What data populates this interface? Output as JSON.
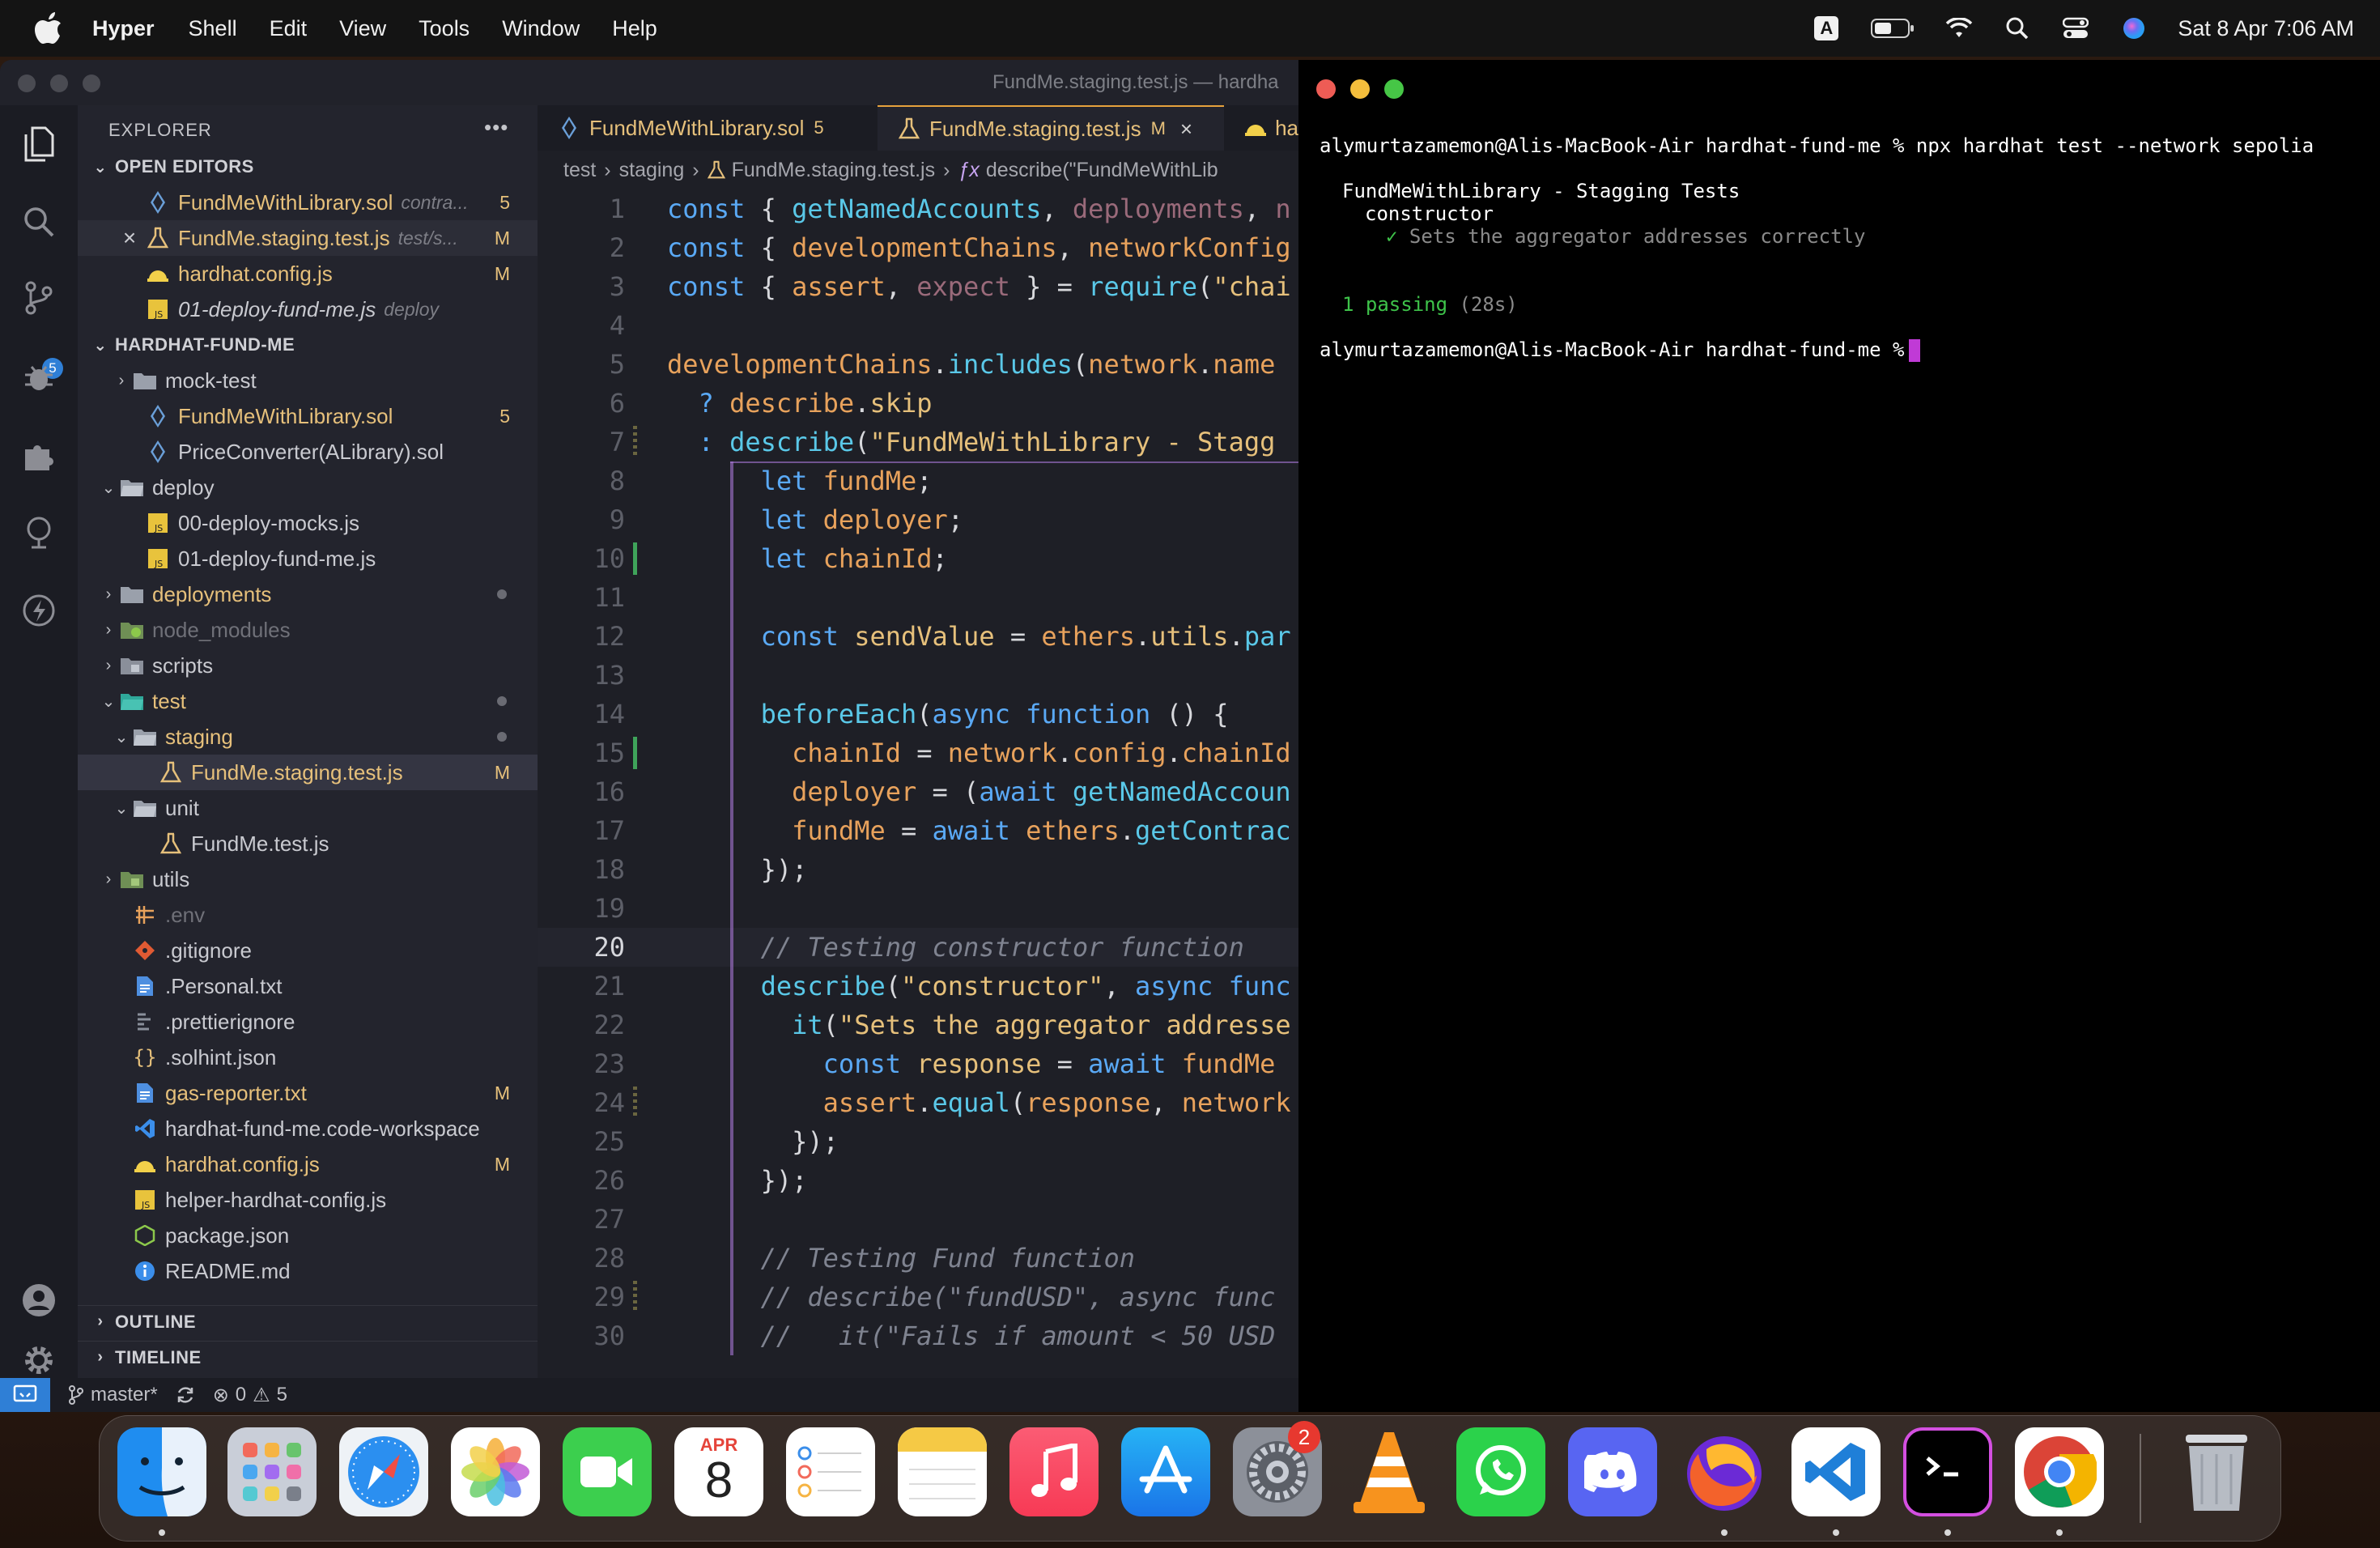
{
  "menubar": {
    "app_name": "Hyper",
    "items": [
      "Shell",
      "Edit",
      "View",
      "Tools",
      "Window",
      "Help"
    ],
    "input_source": "A",
    "clock": "Sat 8 Apr  7:06 AM"
  },
  "vscode": {
    "window_title": "FundMe.staging.test.js — hardha",
    "activity_bar": {
      "source_control_badge": "5"
    },
    "explorer": {
      "title": "EXPLORER",
      "more": "•••",
      "open_editors_title": "OPEN EDITORS",
      "open_editors": [
        {
          "name": "FundMeWithLibrary.sol",
          "desc": "contra...",
          "tag": "5"
        },
        {
          "name": "FundMe.staging.test.js",
          "desc": "test/s...",
          "tag": "M",
          "close": "×"
        },
        {
          "name": "hardhat.config.js",
          "desc": "",
          "tag": "M"
        },
        {
          "name": "01-deploy-fund-me.js",
          "desc": "deploy",
          "tag": ""
        }
      ],
      "project_title": "HARDHAT-FUND-ME",
      "tree": [
        {
          "name": "mock-test",
          "tag": ""
        },
        {
          "name": "FundMeWithLibrary.sol",
          "tag": "5"
        },
        {
          "name": "PriceConverter(ALibrary).sol",
          "tag": ""
        },
        {
          "name": "deploy",
          "tag": ""
        },
        {
          "name": "00-deploy-mocks.js",
          "tag": ""
        },
        {
          "name": "01-deploy-fund-me.js",
          "tag": ""
        },
        {
          "name": "deployments",
          "tag": ""
        },
        {
          "name": "node_modules",
          "tag": ""
        },
        {
          "name": "scripts",
          "tag": ""
        },
        {
          "name": "test",
          "tag": ""
        },
        {
          "name": "staging",
          "tag": ""
        },
        {
          "name": "FundMe.staging.test.js",
          "tag": "M"
        },
        {
          "name": "unit",
          "tag": ""
        },
        {
          "name": "FundMe.test.js",
          "tag": ""
        },
        {
          "name": "utils",
          "tag": ""
        },
        {
          "name": ".env",
          "tag": ""
        },
        {
          "name": ".gitignore",
          "tag": ""
        },
        {
          "name": ".Personal.txt",
          "tag": ""
        },
        {
          "name": ".prettierignore",
          "tag": ""
        },
        {
          "name": ".solhint.json",
          "tag": ""
        },
        {
          "name": "gas-reporter.txt",
          "tag": "M"
        },
        {
          "name": "hardhat-fund-me.code-workspace",
          "tag": ""
        },
        {
          "name": "hardhat.config.js",
          "tag": "M"
        },
        {
          "name": "helper-hardhat-config.js",
          "tag": ""
        },
        {
          "name": "package.json",
          "tag": ""
        },
        {
          "name": "README.md",
          "tag": ""
        }
      ],
      "outline_title": "OUTLINE",
      "timeline_title": "TIMELINE"
    },
    "tabs": [
      {
        "label": "FundMeWithLibrary.sol",
        "meta": "5",
        "close": ""
      },
      {
        "label": "FundMe.staging.test.js",
        "meta": "M",
        "close": "×"
      },
      {
        "label": "ha",
        "meta": "",
        "close": ""
      }
    ],
    "breadcrumb": [
      "test",
      "staging",
      "FundMe.staging.test.js",
      "describe(\"FundMeWithLib"
    ],
    "code": {
      "line_numbers": [
        "1",
        "2",
        "3",
        "4",
        "5",
        "6",
        "7",
        "8",
        "9",
        "10",
        "11",
        "12",
        "13",
        "14",
        "15",
        "16",
        "17",
        "18",
        "19",
        "20",
        "21",
        "22",
        "23",
        "24",
        "25",
        "26",
        "27",
        "28",
        "29",
        "30"
      ],
      "current_line": "20"
    },
    "statusbar": {
      "branch": "master*",
      "errors": "0",
      "warnings": "5"
    }
  },
  "terminal": {
    "command_line": "alymurtazamemon@Alis-MacBook-Air hardhat-fund-me % npx hardhat test --network sepolia",
    "suite": "FundMeWithLibrary - Stagging Tests",
    "describe": "constructor",
    "check": "✓",
    "test_name": "Sets the aggregator addresses correctly",
    "passing": "1 passing",
    "duration": "(28s)",
    "prompt": "alymurtazamemon@Alis-MacBook-Air hardhat-fund-me %"
  },
  "dock": {
    "calendar_month": "APR",
    "calendar_day": "8",
    "settings_badge": "2",
    "apps": [
      "finder-icon",
      "launchpad-icon",
      "safari-icon",
      "photos-icon",
      "facetime-icon",
      "calendar-icon",
      "reminders-icon",
      "notes-icon",
      "music-icon",
      "app-store-icon",
      "system-settings-icon",
      "vlc-icon",
      "whatsapp-icon",
      "discord-icon",
      "firefox-icon",
      "vscode-icon",
      "hyper-icon",
      "chrome-icon",
      "trash-icon"
    ]
  },
  "colors": {
    "accent_yellow": "#e6c07b",
    "vscode_bg": "#1e1f26",
    "terminal_bg": "#000000",
    "terminal_cursor": "#c03ad6",
    "pass_green": "#3ec34a"
  }
}
